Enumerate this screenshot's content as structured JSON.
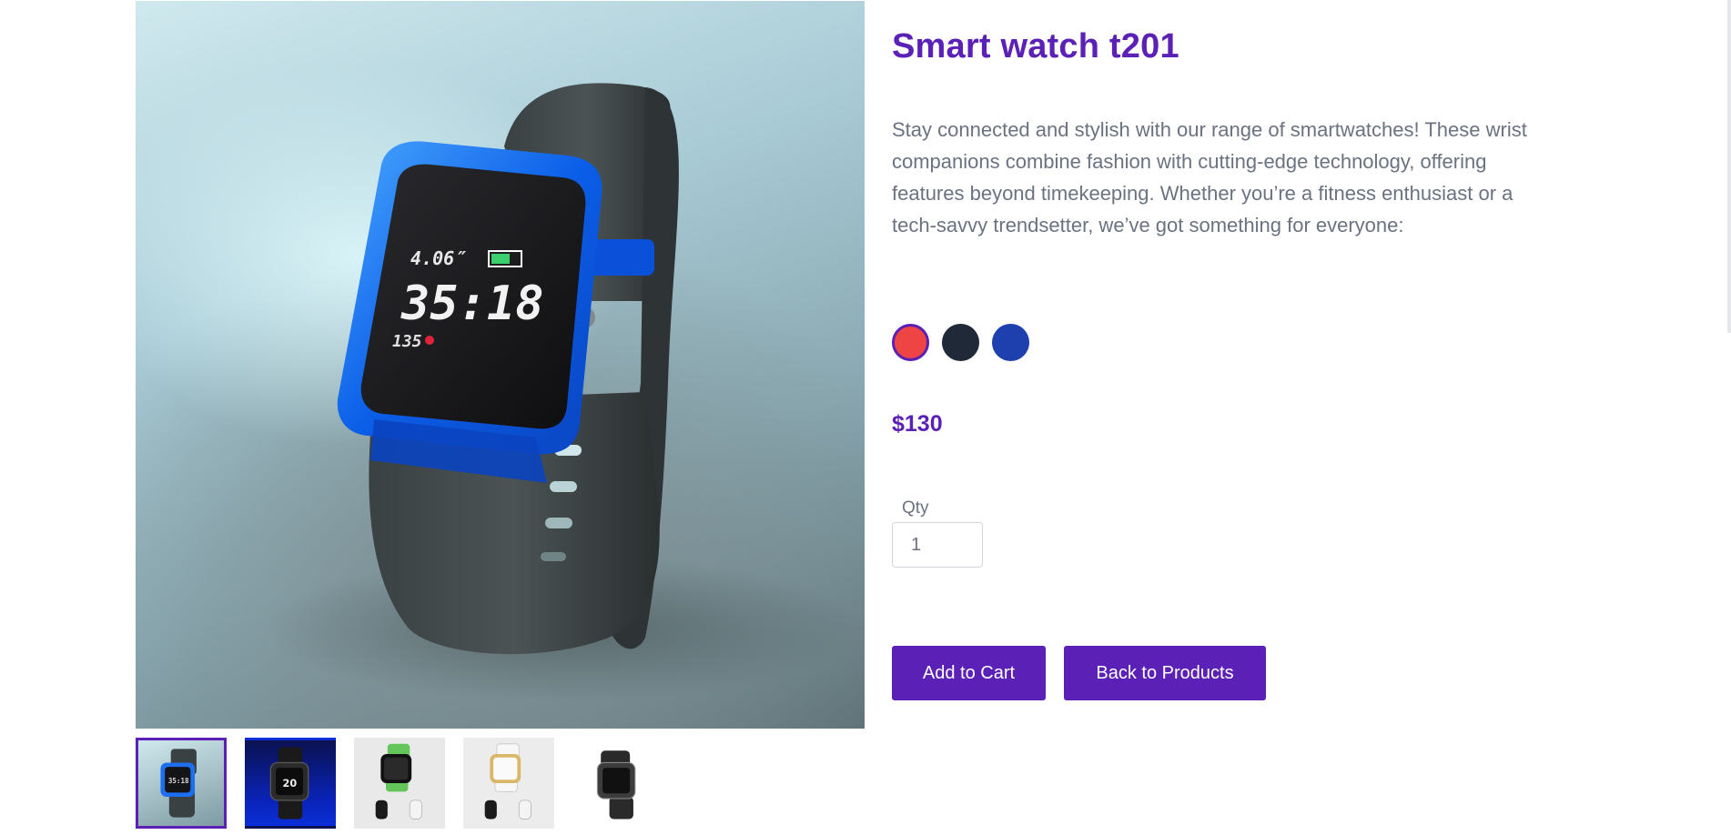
{
  "product": {
    "title": "Smart watch t201",
    "description": "Stay connected and stylish with our range of smartwatches! These wrist companions combine fashion with cutting-edge technology, offering features beyond timekeeping. Whether you’re a fitness enthusiast or a tech-savvy trendsetter, we’ve got something for everyone:",
    "price": "$130",
    "colors": [
      {
        "name": "red",
        "hex": "#ef4444",
        "selected": true
      },
      {
        "name": "navy",
        "hex": "#1f2937",
        "selected": false
      },
      {
        "name": "blue",
        "hex": "#1e40af",
        "selected": false
      }
    ],
    "accent_color": "#5b21b6"
  },
  "watch_screen": {
    "size": "4.06″",
    "time": "35:18",
    "heart_rate": "135"
  },
  "quantity": {
    "label": "Qty",
    "value": "1"
  },
  "actions": {
    "add_to_cart": "Add to Cart",
    "back_to_products": "Back to Products"
  },
  "thumbnails": [
    {
      "icon": "blue-smartwatch-thumbnail",
      "active": true
    },
    {
      "icon": "dark-smartwatch-thumbnail",
      "active": false
    },
    {
      "icon": "green-smartwatch-thumbnail",
      "active": false
    },
    {
      "icon": "white-smartwatch-thumbnail",
      "active": false
    },
    {
      "icon": "black-smartwatch-thumbnail",
      "active": false
    }
  ],
  "thumb2_screen_text": "20"
}
